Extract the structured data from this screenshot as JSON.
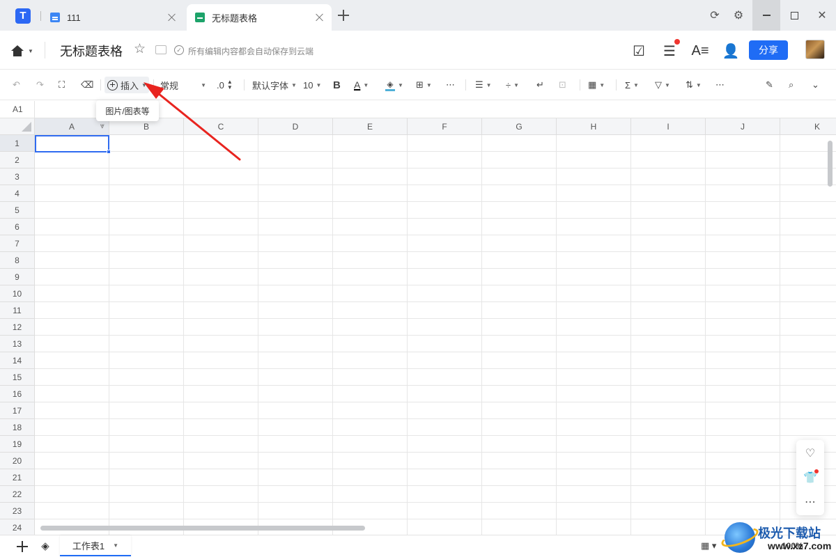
{
  "tabs": [
    {
      "label": "111"
    },
    {
      "label": "无标题表格"
    }
  ],
  "header": {
    "doc_title": "无标题表格",
    "save_status": "所有编辑内容都会自动保存到云端",
    "share_label": "分享"
  },
  "toolbar": {
    "insert_label": "插入",
    "format_label": "常规",
    "decimal_label": ".0",
    "font_label": "默认字体",
    "size_label": "10",
    "bold_label": "B",
    "font_color_label": "A",
    "insert_tooltip": "图片/图表等"
  },
  "formula_bar": {
    "cell_ref": "A1"
  },
  "grid": {
    "columns": [
      "A",
      "B",
      "C",
      "D",
      "E",
      "F",
      "G",
      "H",
      "I",
      "J",
      "K"
    ],
    "rows": [
      "1",
      "2",
      "3",
      "4",
      "5",
      "6",
      "7",
      "8",
      "9",
      "10",
      "11",
      "12",
      "13",
      "14",
      "15",
      "16",
      "17",
      "18",
      "19",
      "20",
      "21",
      "22",
      "23",
      "24"
    ],
    "selected_cell": "A1"
  },
  "sheets": [
    {
      "label": "工作表1"
    }
  ],
  "zoom": "100%",
  "watermark": {
    "title": "极光下载站",
    "url": "www.xz7.com"
  },
  "colors": {
    "accent": "#1f6cf5",
    "sheet_green": "#1da36a",
    "notify_red": "#f0342e",
    "arrow_red": "#e8241f"
  }
}
